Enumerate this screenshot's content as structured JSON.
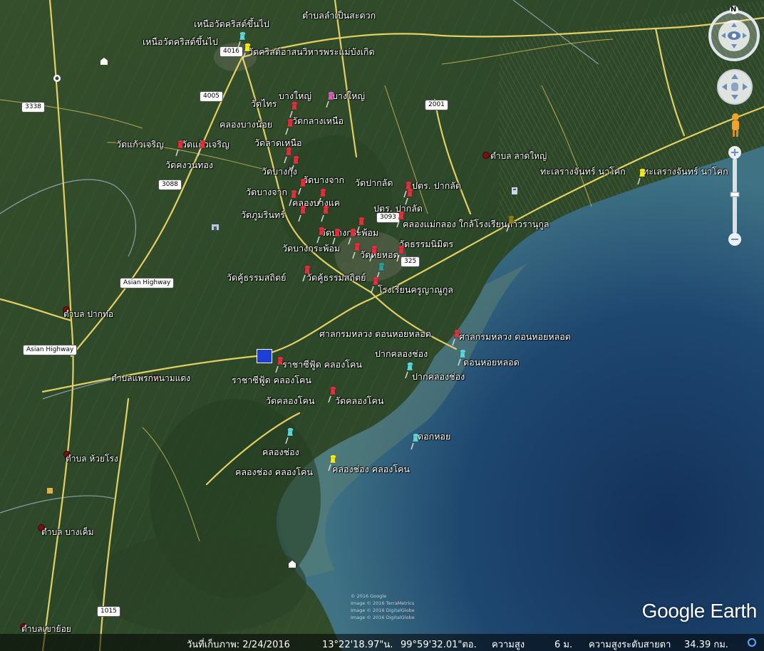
{
  "labels": [
    {
      "id": "l1",
      "text": "ตำบลลำเป็นสะดวก"
    },
    {
      "id": "l2",
      "text": "เหนือวัดคริสต์ขึ้นไป"
    },
    {
      "id": "l3",
      "text": "เหนือวัดคริสต์ขึ้นไป"
    },
    {
      "id": "l4",
      "text": "วัดคริสต์อาสนวิหารพระแม่บังเกิด"
    },
    {
      "id": "l5",
      "text": "บางใหญ่"
    },
    {
      "id": "l6",
      "text": "บางใหญ่"
    },
    {
      "id": "l7",
      "text": "วัดไทร"
    },
    {
      "id": "l8",
      "text": "วัดกลางเหนือ"
    },
    {
      "id": "l9",
      "text": "คลองบางน้อย"
    },
    {
      "id": "l10",
      "text": "วัดแก้วเจริญ"
    },
    {
      "id": "l11",
      "text": "วัดแก้วเจริญ"
    },
    {
      "id": "l12",
      "text": "วัดลาดเหนือ"
    },
    {
      "id": "l13",
      "text": "วัดคงวนทอง"
    },
    {
      "id": "l14",
      "text": "วัดบางกุ้ง"
    },
    {
      "id": "l15",
      "text": "วัดบางจาก"
    },
    {
      "id": "l16",
      "text": "วัดปากลัด"
    },
    {
      "id": "l17",
      "text": "ปตร. ปากลัด"
    },
    {
      "id": "l18",
      "text": "วัดบางจาก"
    },
    {
      "id": "l19",
      "text": "คลองบางแค"
    },
    {
      "id": "l20",
      "text": "ปตร. ปากลัด"
    },
    {
      "id": "l21",
      "text": "วัดภูมรินทร์"
    },
    {
      "id": "l22",
      "text": "คลองแม่กลอง ใกล้โรงเรียนถาวรานุกูล"
    },
    {
      "id": "l23",
      "text": "วัดบางกระพ้อม"
    },
    {
      "id": "l24",
      "text": "วัดธรรมนิมิตร"
    },
    {
      "id": "l25",
      "text": "วัดบางกระพ้อม"
    },
    {
      "id": "l26",
      "text": "วัดหัยหอด"
    },
    {
      "id": "l27",
      "text": "วัดคู้ธรรมสถิตย์"
    },
    {
      "id": "l28",
      "text": "วัดคู้ธรรมสถิตย์"
    },
    {
      "id": "l29",
      "text": "โรงเรียนครูญาณูกูล"
    },
    {
      "id": "l30",
      "text": "ศาลกรมหลวง ดอนหอยหลอด"
    },
    {
      "id": "l31",
      "text": "ศาลกรมหลวง ดอนหอยหลอด"
    },
    {
      "id": "l32",
      "text": "ปากคลองช่อง"
    },
    {
      "id": "l33",
      "text": "ดอนหอยหลอด"
    },
    {
      "id": "l34",
      "text": "ราชาซีฟู้ด คลองโคน"
    },
    {
      "id": "l35",
      "text": "ราชาซีฟู้ด คลองโคน"
    },
    {
      "id": "l36",
      "text": "ปากคลองช่อง"
    },
    {
      "id": "l37",
      "text": "วัดคลองโคน"
    },
    {
      "id": "l38",
      "text": "วัดคลองโคน"
    },
    {
      "id": "l39",
      "text": "ดอกหอย"
    },
    {
      "id": "l40",
      "text": "คลองช่อง"
    },
    {
      "id": "l41",
      "text": "คลองช่อง คลองโคน"
    },
    {
      "id": "l42",
      "text": "คลองช่อง คลองโคน"
    },
    {
      "id": "l43",
      "text": "ทะเลรางจันทร์ นาโคก"
    },
    {
      "id": "l44",
      "text": "ทะเลรางจันทร์ นาโคก"
    }
  ],
  "places": [
    {
      "id": "p1",
      "text": "ตำบล ลาดใหญ่"
    },
    {
      "id": "p2",
      "text": "ตำบล ปากท่อ"
    },
    {
      "id": "p3",
      "text": "ตำบลแพรกหนามแดง"
    },
    {
      "id": "p4",
      "text": "ตำบล ห้วยโรง"
    },
    {
      "id": "p5",
      "text": "ตำบล บางเค็ม"
    },
    {
      "id": "p6",
      "text": "ตำบลเขาย้อย"
    }
  ],
  "shields": [
    {
      "id": "s1",
      "text": "4016"
    },
    {
      "id": "s2",
      "text": "4005"
    },
    {
      "id": "s3",
      "text": "3338"
    },
    {
      "id": "s4",
      "text": "2001"
    },
    {
      "id": "s5",
      "text": "3088"
    },
    {
      "id": "s6",
      "text": "3093"
    },
    {
      "id": "s7",
      "text": "325"
    },
    {
      "id": "s8",
      "text": "Asian Highway"
    },
    {
      "id": "s9",
      "text": "Asian Highway"
    },
    {
      "id": "s10",
      "text": "1015"
    },
    {
      "id": "s11",
      "text": "4016"
    }
  ],
  "road_labels": {
    "asian_highway_1": "Asian Highway 2",
    "asian_highway_2": "Asian Highway 3088"
  },
  "status_bar": {
    "date_label": "วันที่เก็บภาพ: 2/24/2016",
    "lat": "13°22'18.97\"น.",
    "lon": "99°59'32.01\"ตอ.",
    "elev_label": "ความสูง",
    "elev_value": "6 ม.",
    "eye_alt_label": "ความสูงระดับสายตา",
    "eye_alt_value": "34.39 กม."
  },
  "logo": "Google Earth",
  "credits": [
    "© 2016 Google",
    "Image © 2016 TerraMetrics",
    "Image © 2016 DigitalGlobe",
    "Image © 2016 DigitalGlobe"
  ],
  "compass_letter": "N",
  "colors": {
    "land": "#2f4a26",
    "sea_deep": "#1a3d63",
    "sea_shallow": "#4d7d86",
    "road": "#e6d36a",
    "red_pin": "#d9343f",
    "cyan_pin": "#5ed5dd",
    "yellow_pin": "#f3ea22",
    "pink_pin": "#d65fbe",
    "olive_pin": "#8a7d1a",
    "teal_pin": "#2e9c99"
  },
  "icons": [
    "red-pushpin-icon",
    "cyan-pushpin-icon",
    "yellow-pushpin-icon",
    "pink-pushpin-icon",
    "olive-pushpin-icon",
    "teal-pushpin-icon",
    "navigation-compass-icon",
    "pan-control-icon",
    "street-view-pegman-icon",
    "zoom-in-icon",
    "zoom-out-icon"
  ]
}
